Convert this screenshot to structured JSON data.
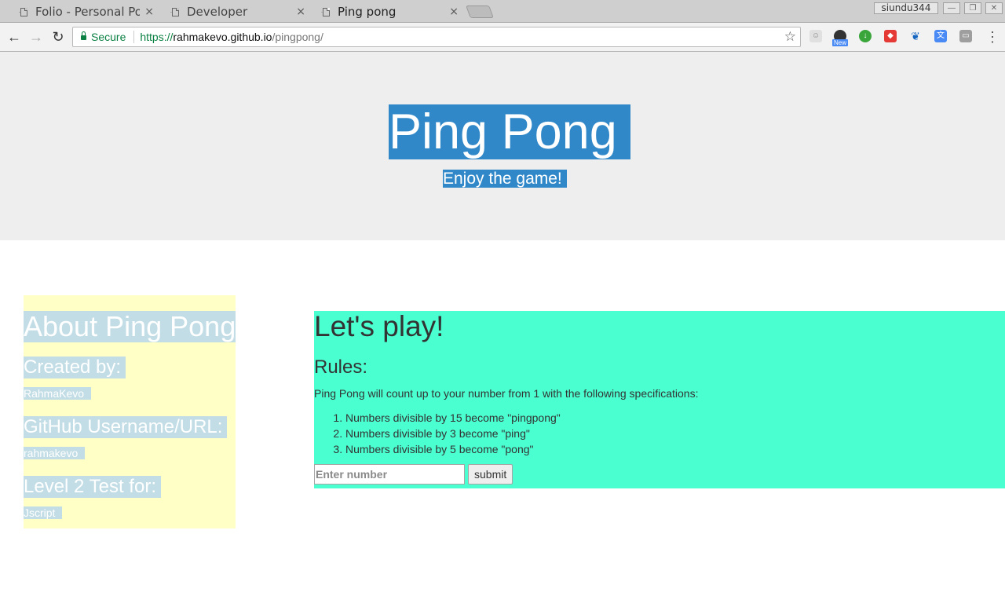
{
  "browser": {
    "tabs": [
      {
        "title": "Folio - Personal Po",
        "active": false
      },
      {
        "title": "Developer",
        "active": false
      },
      {
        "title": "Ping pong",
        "active": true
      }
    ],
    "tab_close_glyph": "×",
    "user_name": "siundu344",
    "secure_label": "Secure",
    "url": {
      "scheme": "https://",
      "host": "rahmakevo.github.io",
      "path": "/pingpong/"
    },
    "extensions": [
      "ghost-icon",
      "speed-dial-icon",
      "download-icon",
      "adblock-icon",
      "butterfly-icon",
      "translate-icon",
      "cast-icon"
    ],
    "extension_badge": "New"
  },
  "jumbotron": {
    "title": "Ping Pong",
    "subtitle": "Enjoy the game!"
  },
  "about": {
    "heading": "About Ping Pong",
    "created_by_label": "Created by:",
    "created_by_value": "RahmaKevo",
    "github_label": "GitHub Username/URL:",
    "github_value": "rahmakevo",
    "level_label": "Level 2 Test for:",
    "level_value": "Jscript"
  },
  "game": {
    "heading": "Let's play!",
    "rules_heading": "Rules:",
    "rules_description": "Ping Pong will count up to your number from 1 with the following specifications:",
    "rules": [
      "Numbers divisible by 15 become \"pingpong\"",
      "Numbers divisible by 3 become \"ping\"",
      "Numbers divisible by 5 become \"pong\""
    ],
    "input_placeholder": "Enter number",
    "input_value": "",
    "submit_label": "submit"
  },
  "colors": {
    "jumbotron_bg": "#eeeeee",
    "title_highlight": "#3188c8",
    "about_bg": "#ffffc6",
    "about_highlight": "#c2dde6",
    "play_bg": "#4affd0",
    "secure_green": "#0b8043"
  }
}
